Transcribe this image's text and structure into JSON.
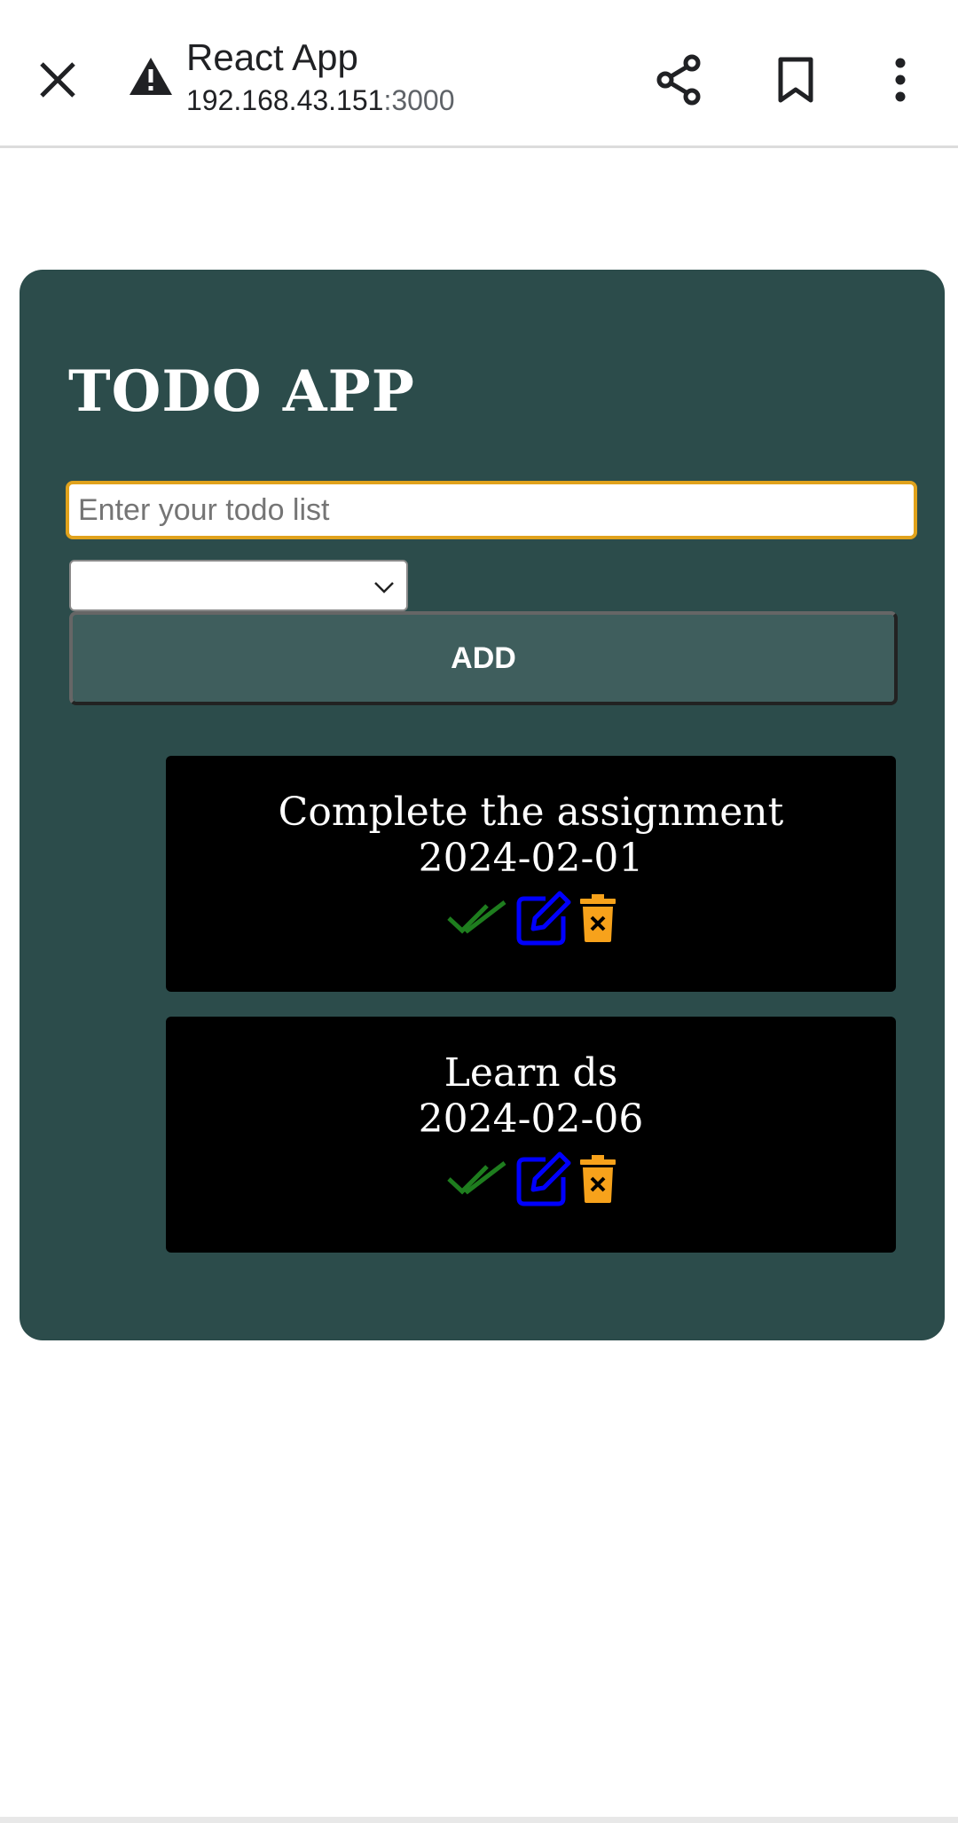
{
  "browser": {
    "page_title": "React App",
    "url_host": "192.168.43.151",
    "url_port": ":3000",
    "icons": {
      "close": "close-icon",
      "security_warning": "warning-icon",
      "share": "share-icon",
      "bookmark": "bookmark-icon",
      "more": "more-vertical-icon"
    }
  },
  "app": {
    "heading": "TODO APP",
    "input": {
      "placeholder": "Enter your todo list",
      "value": ""
    },
    "date_select": {
      "selected": ""
    },
    "add_label": "ADD",
    "todos": [
      {
        "text": "Complete the assignment",
        "date": "2024-02-01"
      },
      {
        "text": "Learn ds",
        "date": "2024-02-06"
      }
    ],
    "action_icons": [
      "check-double-icon",
      "edit-icon",
      "trash-icon"
    ]
  },
  "colors": {
    "card_bg": "#2c4c4b",
    "button_bg": "#3f5e5d",
    "input_border": "#e0a21c",
    "complete_icon": "#1e7d1e",
    "edit_icon": "#0000ff",
    "delete_icon": "#f7a21b"
  }
}
